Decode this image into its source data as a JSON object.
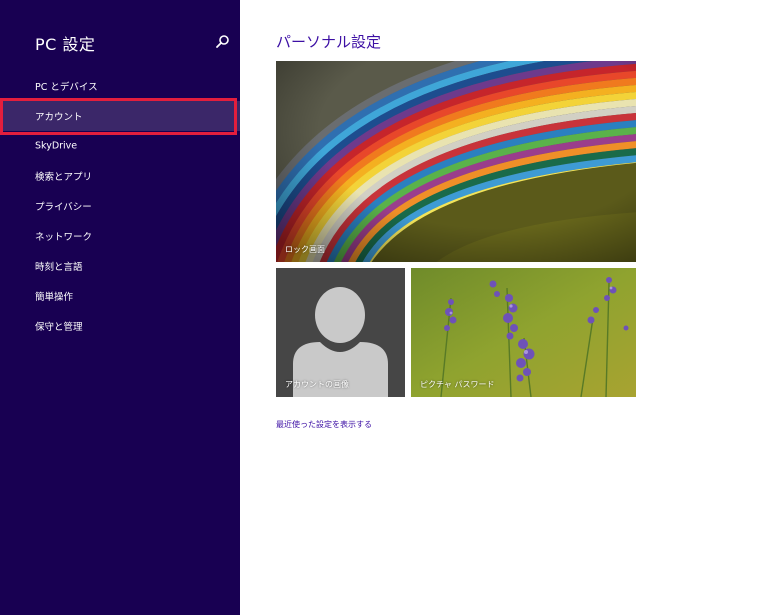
{
  "sidebar": {
    "title": "PC 設定",
    "search_icon": "search-icon",
    "items": [
      {
        "label": "PC とデバイス"
      },
      {
        "label": "アカウント"
      },
      {
        "label": "SkyDrive"
      },
      {
        "label": "検索とアプリ"
      },
      {
        "label": "プライバシー"
      },
      {
        "label": "ネットワーク"
      },
      {
        "label": "時刻と言語"
      },
      {
        "label": "簡単操作"
      },
      {
        "label": "保守と管理"
      }
    ],
    "selected": "アカウント"
  },
  "main": {
    "title": "パーソナル設定",
    "tiles": {
      "lock_screen": "ロック画面",
      "account_picture": "アカウントの画像",
      "picture_password": "ピクチャ パスワード"
    },
    "recent_link": "最近使った設定を表示する"
  },
  "colors": {
    "sidebar_bg": "#180052",
    "selected_item_bg": "#3b2769",
    "highlight_border": "#e31e3d",
    "accent_text": "#3c0fa4",
    "account_tile_bg": "#464646"
  }
}
